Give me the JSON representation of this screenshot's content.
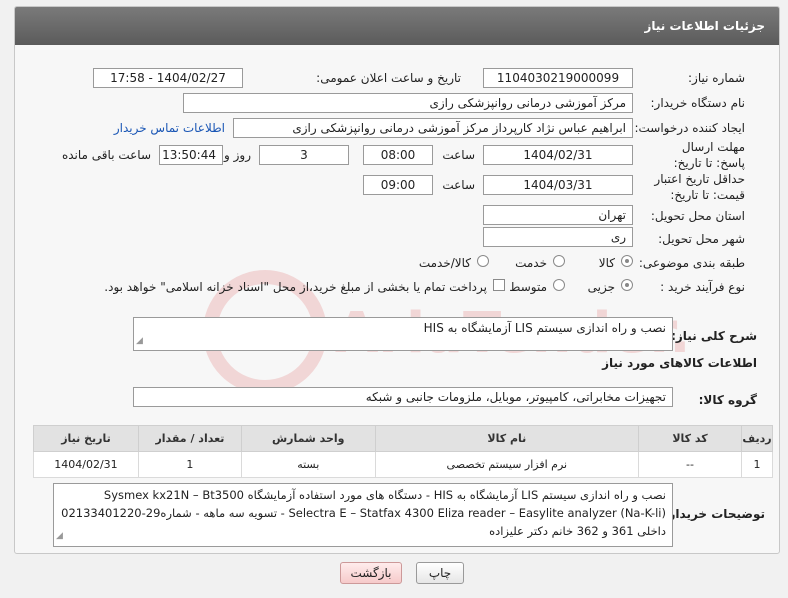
{
  "header": {
    "title": "جزئیات اطلاعات نیاز"
  },
  "form": {
    "need_number": {
      "label": "شماره نیاز:",
      "value": "1104030219000099"
    },
    "announce": {
      "label": "تاریخ و ساعت اعلان عمومی:",
      "value": "1404/02/27 - 17:58"
    },
    "buyer_org": {
      "label": "نام دستگاه خریدار:",
      "value": "مرکز آموزشی درمانی روانپزشکی رازی"
    },
    "creator": {
      "label": "ایجاد کننده درخواست:",
      "value": "ابراهیم عباس نژاد کارپرداز مرکز آموزشی درمانی روانپزشکی رازی",
      "contact_link": "اطلاعات تماس خریدار"
    },
    "reply_deadline": {
      "label": "مهلت ارسال پاسخ: تا تاریخ:",
      "date": "1404/02/31",
      "time_label": "ساعت",
      "time": "08:00",
      "days": "3",
      "days_label": "روز و",
      "remaining": "13:50:44",
      "remaining_label": "ساعت باقی مانده"
    },
    "price_validity": {
      "label": "حداقل تاریخ اعتبار قیمت: تا تاریخ:",
      "date": "1404/03/31",
      "time_label": "ساعت",
      "time": "09:00"
    },
    "province": {
      "label": "استان محل تحویل:",
      "value": "تهران"
    },
    "city": {
      "label": "شهر محل تحویل:",
      "value": "ری"
    },
    "category": {
      "label": "طبقه بندی موضوعی:",
      "options": [
        "کالا",
        "خدمت",
        "کالا/خدمت"
      ]
    },
    "process": {
      "label": "نوع فرآیند خرید :",
      "options": [
        "جزیی",
        "متوسط"
      ],
      "note": "پرداخت تمام یا بخشی از مبلغ خرید،از محل \"اسناد خزانه اسلامی\" خواهد بود."
    },
    "general_desc": {
      "label": "شرح کلی نیاز:",
      "value": "نصب و راه اندازی سیستم LIS آزمایشگاه به HIS"
    }
  },
  "goods": {
    "section_title": "اطلاعات کالاهای مورد نیاز",
    "group_label": "گروه کالا:",
    "group_value": "تجهیزات مخابراتی، کامپیوتر، موبایل، ملزومات جانبی و شبکه",
    "columns": [
      "ردیف",
      "کد کالا",
      "نام کالا",
      "واحد شمارش",
      "تعداد / مقدار",
      "تاریخ نیاز"
    ],
    "rows": [
      [
        "1",
        "--",
        "نرم افزار سیستم تخصصی",
        "بسته",
        "1",
        "1404/02/31"
      ]
    ]
  },
  "buyer_notes": {
    "label": "توضیحات خریدار:",
    "lines": [
      "نصب و راه اندازی سیستم LIS آزمایشگاه به HIS - دستگاه های مورد استفاده آزمایشگاه Sysmex kx21N – Bt3500",
      "Selectra E – Statfax 4300 Eliza reader – Easylite analyzer (Na-K-li) - تسویه سه ماهه -  شماره29-02133401220",
      "داخلی 361 و 362 خانم دکتر علیزاده"
    ]
  },
  "buttons": {
    "print": "چاپ",
    "back": "بازگشت"
  },
  "watermark": {
    "text": "AriaTender.net"
  }
}
